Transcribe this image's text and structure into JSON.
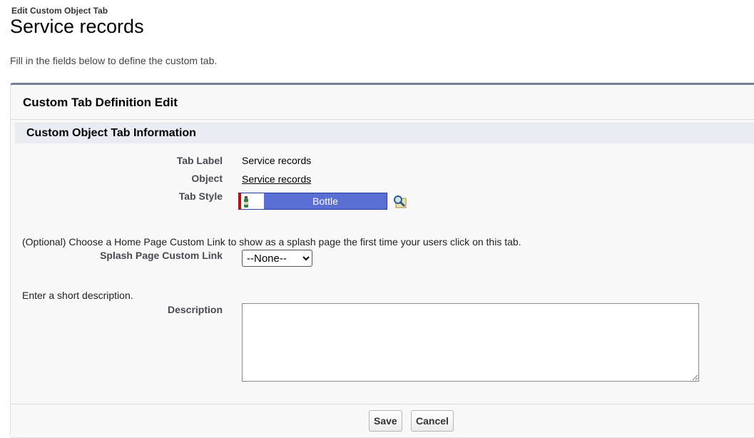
{
  "header": {
    "breadcrumb": "Edit Custom Object Tab",
    "title": "Service records",
    "intro": "Fill in the fields below to define the custom tab."
  },
  "panel": {
    "title": "Custom Tab Definition Edit",
    "section_title": "Custom Object Tab Information"
  },
  "fields": {
    "tab_label": {
      "label": "Tab Label",
      "value": "Service records"
    },
    "object": {
      "label": "Object",
      "value": "Service records"
    },
    "tab_style": {
      "label": "Tab Style",
      "value": "Bottle",
      "icon": "bottle-icon",
      "lookup_icon": "lookup-icon",
      "color": "#5a6fd4",
      "accent": "#b31212"
    },
    "splash_help": "(Optional) Choose a Home Page Custom Link to show as a splash page the first time your users click on this tab.",
    "splash": {
      "label": "Splash Page Custom Link",
      "selected": "--None--"
    },
    "description_help": "Enter a short description.",
    "description": {
      "label": "Description",
      "value": ""
    }
  },
  "buttons": {
    "save": "Save",
    "cancel": "Cancel"
  }
}
